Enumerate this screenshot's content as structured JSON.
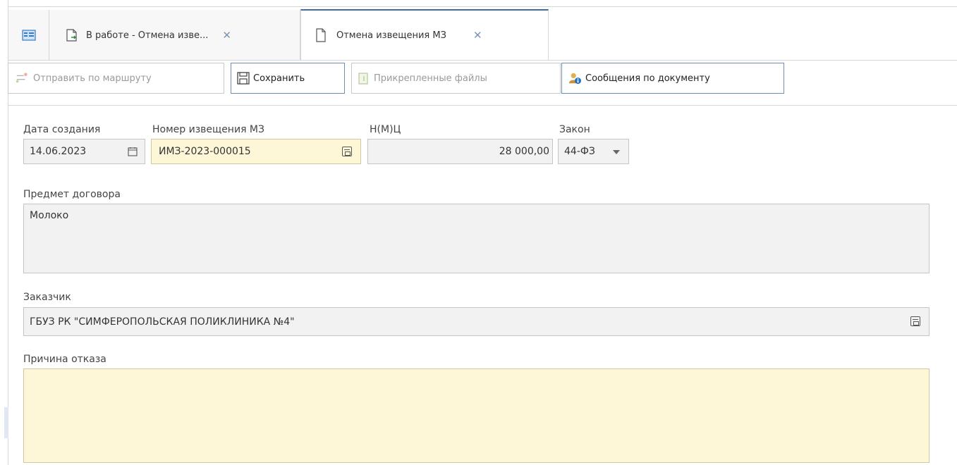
{
  "tabs": [
    {
      "label": "В работе - Отмена изве...",
      "close": "✕"
    },
    {
      "label": "Отмена извещения МЗ",
      "close": "✕"
    }
  ],
  "toolbar": {
    "send_route": "Отправить по маршруту",
    "save": "Сохранить",
    "attached_files": "Прикрепленные файлы",
    "messages": "Сообщения по документу"
  },
  "form": {
    "creation_date_label": "Дата создания",
    "creation_date_value": "14.06.2023",
    "notice_number_label": "Номер извещения МЗ",
    "notice_number_value": "ИМЗ-2023-000015",
    "nmc_label": "Н(М)Ц",
    "nmc_value": "28 000,00",
    "law_label": "Закон",
    "law_value": "44-ФЗ",
    "subject_label": "Предмет договора",
    "subject_value": "Молоко",
    "customer_label": "Заказчик",
    "customer_value": "ГБУЗ РК \"СИМФЕРОПОЛЬСКАЯ ПОЛИКЛИНИКА №4\"",
    "reason_label": "Причина отказа",
    "reason_value": ""
  },
  "colors": {
    "accent": "#3a6ea5",
    "required_field_bg": "#fdf7d8",
    "readonly_field_bg": "#f2f2f2"
  }
}
